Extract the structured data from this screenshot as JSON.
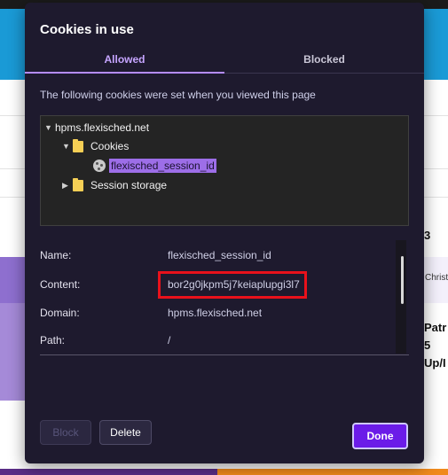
{
  "dialog": {
    "title": "Cookies in use",
    "tabs": [
      {
        "label": "Allowed",
        "active": true
      },
      {
        "label": "Blocked",
        "active": false
      }
    ],
    "description": "The following cookies were set when you viewed this page",
    "tree": {
      "site": "hpms.flexisched.net",
      "folders": [
        {
          "label": "Cookies",
          "expanded": true,
          "children": [
            "flexisched_session_id"
          ]
        },
        {
          "label": "Session storage",
          "expanded": false
        }
      ]
    },
    "details": {
      "name_label": "Name:",
      "name_value": "flexisched_session_id",
      "content_label": "Content:",
      "content_value": "bor2g0jkpm5j7keiaplupgi3l7",
      "domain_label": "Domain:",
      "domain_value": "hpms.flexisched.net",
      "path_label": "Path:",
      "path_value": "/"
    },
    "buttons": {
      "block": "Block",
      "delete": "Delete",
      "done": "Done"
    }
  },
  "background": {
    "snippet_number": "3",
    "snippet_small": "Christ",
    "snippet_line1": "Patr",
    "snippet_line2": "5",
    "snippet_line3": "Up/I"
  },
  "colors": {
    "dialog_bg": "#1e1a2e",
    "accent": "#b48cff",
    "done_button": "#6b1ce8",
    "highlight": "#e8111b",
    "tree_bg": "#242424",
    "selected_item": "#9d6ee8"
  },
  "icons": [
    "expand-arrow-icon",
    "folder-icon",
    "cookie-icon"
  ]
}
